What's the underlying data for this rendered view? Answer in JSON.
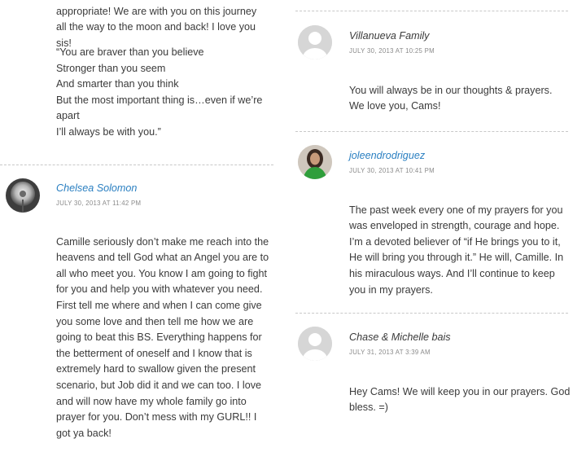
{
  "left_column": {
    "intro_text": "appropriate! We are with you on this journey all the way to the moon and back! I love you sis!",
    "verse_lines": [
      "“You are braver than you believe",
      "Stronger than you seem",
      "And smarter than you think",
      "But the most important thing is…even if we’re",
      "apart",
      "I’ll always be with you.”"
    ],
    "comment": {
      "author": "Chelsea Solomon",
      "date": "JULY 30, 2013 AT 11:42 PM",
      "text": "Camille seriously don’t make me reach into the heavens and tell God what an Angel you are to all who meet you. You know I am going to fight for you and help you with whatever you need. First tell me where and when I can come give you some love and then tell me how we are going to beat this BS. Everything happens for the betterment of oneself and I know that is extremely hard to swallow given the present scenario, but Job did it and we can too. I love and will now have my whole family go into prayer for you. Don’t mess with my GURL!! I got ya back!"
    }
  },
  "right_column": {
    "comments": [
      {
        "author": "Villanueva Family",
        "date": "JULY 30, 2013 AT 10:25 PM",
        "text": "You will always be in our thoughts & prayers. We love you, Cams!",
        "author_is_link": false,
        "avatar_icon": "default-avatar-icon"
      },
      {
        "author": "joleendrodriguez",
        "date": "JULY 30, 2013 AT 10:41 PM",
        "text": "The past week every one of my prayers for you was enveloped in strength, courage and hope. I’m a devoted believer of “if He brings you to it, He will bring you through it.” He will, Camille. In his miraculous ways. And I’ll continue to keep you in my prayers.",
        "author_is_link": true,
        "avatar_icon": "user-photo-avatar"
      },
      {
        "author": "Chase & Michelle bais",
        "date": "JULY 31, 2013 AT 3:39 AM",
        "text": "Hey Cams! We will keep you in our prayers. God bless. =)",
        "author_is_link": false,
        "avatar_icon": "default-avatar-icon"
      }
    ]
  },
  "colors": {
    "link": "#2a7fc1",
    "text": "#3a3a3a",
    "meta": "#8a8a8a",
    "divider": "#c8c8c8",
    "avatar_placeholder": "#d9d9d9"
  }
}
